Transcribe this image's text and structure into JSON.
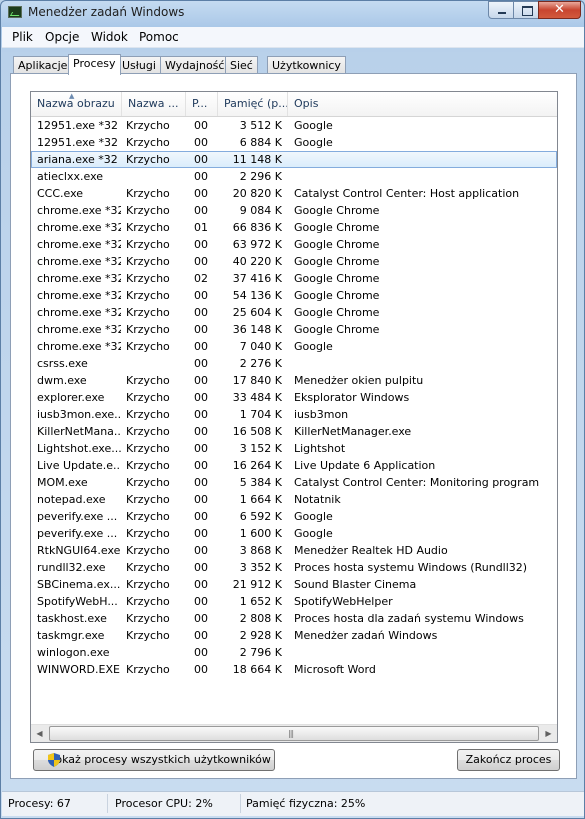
{
  "window": {
    "title": "Menedżer zadań Windows"
  },
  "menu": [
    "Plik",
    "Opcje",
    "Widok",
    "Pomoc"
  ],
  "tabs": [
    "Aplikacje",
    "Procesy",
    "Usługi",
    "Wydajność",
    "Sieć",
    "Użytkownicy"
  ],
  "active_tab": "Procesy",
  "columns": [
    "Nazwa obrazu",
    "Nazwa ...",
    "P...",
    "Pamięć (p...",
    "Opis"
  ],
  "sort_indicator": "caret-up-icon",
  "rows": [
    {
      "name": "12951.exe *32",
      "user": "Krzycho",
      "cpu": "00",
      "mem": "3 512 K",
      "desc": "Google"
    },
    {
      "name": "12951.exe *32",
      "user": "Krzycho",
      "cpu": "00",
      "mem": "6 884 K",
      "desc": "Google"
    },
    {
      "name": "ariana.exe *32",
      "user": "Krzycho",
      "cpu": "00",
      "mem": "11 148 K",
      "desc": ""
    },
    {
      "name": "atieclxx.exe",
      "user": "",
      "cpu": "00",
      "mem": "2 296 K",
      "desc": ""
    },
    {
      "name": "CCC.exe",
      "user": "Krzycho",
      "cpu": "00",
      "mem": "20 820 K",
      "desc": "Catalyst Control Center: Host application"
    },
    {
      "name": "chrome.exe *32",
      "user": "Krzycho",
      "cpu": "00",
      "mem": "9 084 K",
      "desc": "Google Chrome"
    },
    {
      "name": "chrome.exe *32",
      "user": "Krzycho",
      "cpu": "01",
      "mem": "66 836 K",
      "desc": "Google Chrome"
    },
    {
      "name": "chrome.exe *32",
      "user": "Krzycho",
      "cpu": "00",
      "mem": "63 972 K",
      "desc": "Google Chrome"
    },
    {
      "name": "chrome.exe *32",
      "user": "Krzycho",
      "cpu": "00",
      "mem": "40 220 K",
      "desc": "Google Chrome"
    },
    {
      "name": "chrome.exe *32",
      "user": "Krzycho",
      "cpu": "02",
      "mem": "37 416 K",
      "desc": "Google Chrome"
    },
    {
      "name": "chrome.exe *32",
      "user": "Krzycho",
      "cpu": "00",
      "mem": "54 136 K",
      "desc": "Google Chrome"
    },
    {
      "name": "chrome.exe *32",
      "user": "Krzycho",
      "cpu": "00",
      "mem": "25 604 K",
      "desc": "Google Chrome"
    },
    {
      "name": "chrome.exe *32",
      "user": "Krzycho",
      "cpu": "00",
      "mem": "36 148 K",
      "desc": "Google Chrome"
    },
    {
      "name": "chrome.exe *32",
      "user": "Krzycho",
      "cpu": "00",
      "mem": "7 040 K",
      "desc": "Google"
    },
    {
      "name": "csrss.exe",
      "user": "",
      "cpu": "00",
      "mem": "2 276 K",
      "desc": ""
    },
    {
      "name": "dwm.exe",
      "user": "Krzycho",
      "cpu": "00",
      "mem": "17 840 K",
      "desc": "Menedżer okien pulpitu"
    },
    {
      "name": "explorer.exe",
      "user": "Krzycho",
      "cpu": "00",
      "mem": "33 484 K",
      "desc": "Eksplorator Windows"
    },
    {
      "name": "iusb3mon.exe...",
      "user": "Krzycho",
      "cpu": "00",
      "mem": "1 704 K",
      "desc": "iusb3mon"
    },
    {
      "name": "KillerNetMana...",
      "user": "Krzycho",
      "cpu": "00",
      "mem": "16 508 K",
      "desc": "KillerNetManager.exe"
    },
    {
      "name": "Lightshot.exe...",
      "user": "Krzycho",
      "cpu": "00",
      "mem": "3 152 K",
      "desc": "Lightshot"
    },
    {
      "name": "Live Update.e...",
      "user": "Krzycho",
      "cpu": "00",
      "mem": "16 264 K",
      "desc": "Live Update 6 Application"
    },
    {
      "name": "MOM.exe",
      "user": "Krzycho",
      "cpu": "00",
      "mem": "5 384 K",
      "desc": "Catalyst Control Center: Monitoring program"
    },
    {
      "name": "notepad.exe",
      "user": "Krzycho",
      "cpu": "00",
      "mem": "1 664 K",
      "desc": "Notatnik"
    },
    {
      "name": "peverify.exe ...",
      "user": "Krzycho",
      "cpu": "00",
      "mem": "6 592 K",
      "desc": "Google"
    },
    {
      "name": "peverify.exe ...",
      "user": "Krzycho",
      "cpu": "00",
      "mem": "1 600 K",
      "desc": "Google"
    },
    {
      "name": "RtkNGUI64.exe",
      "user": "Krzycho",
      "cpu": "00",
      "mem": "3 868 K",
      "desc": "Menedżer Realtek HD Audio"
    },
    {
      "name": "rundll32.exe",
      "user": "Krzycho",
      "cpu": "00",
      "mem": "3 352 K",
      "desc": "Proces hosta systemu Windows (Rundll32)"
    },
    {
      "name": "SBCinema.ex...",
      "user": "Krzycho",
      "cpu": "00",
      "mem": "21 912 K",
      "desc": "Sound Blaster Cinema"
    },
    {
      "name": "SpotifyWebH...",
      "user": "Krzycho",
      "cpu": "00",
      "mem": "1 652 K",
      "desc": "SpotifyWebHelper"
    },
    {
      "name": "taskhost.exe",
      "user": "Krzycho",
      "cpu": "00",
      "mem": "2 808 K",
      "desc": "Proces hosta dla zadań systemu Windows"
    },
    {
      "name": "taskmgr.exe",
      "user": "Krzycho",
      "cpu": "00",
      "mem": "2 928 K",
      "desc": "Menedżer zadań Windows"
    },
    {
      "name": "winlogon.exe",
      "user": "",
      "cpu": "00",
      "mem": "2 796 K",
      "desc": ""
    },
    {
      "name": "WINWORD.EXE",
      "user": "Krzycho",
      "cpu": "00",
      "mem": "18 664 K",
      "desc": "Microsoft Word"
    }
  ],
  "selected_row": 2,
  "buttons": {
    "show_all": "Pokaż procesy wszystkich użytkowników",
    "end_process": "Zakończ proces"
  },
  "status": {
    "processes": "Procesy: 67",
    "cpu": "Procesor CPU: 2%",
    "memory": "Pamięć fizyczna: 25%"
  },
  "colors": {
    "selection": "#d9ecfb",
    "selection_border": "#84acdd",
    "close_button": "#c8452f"
  }
}
